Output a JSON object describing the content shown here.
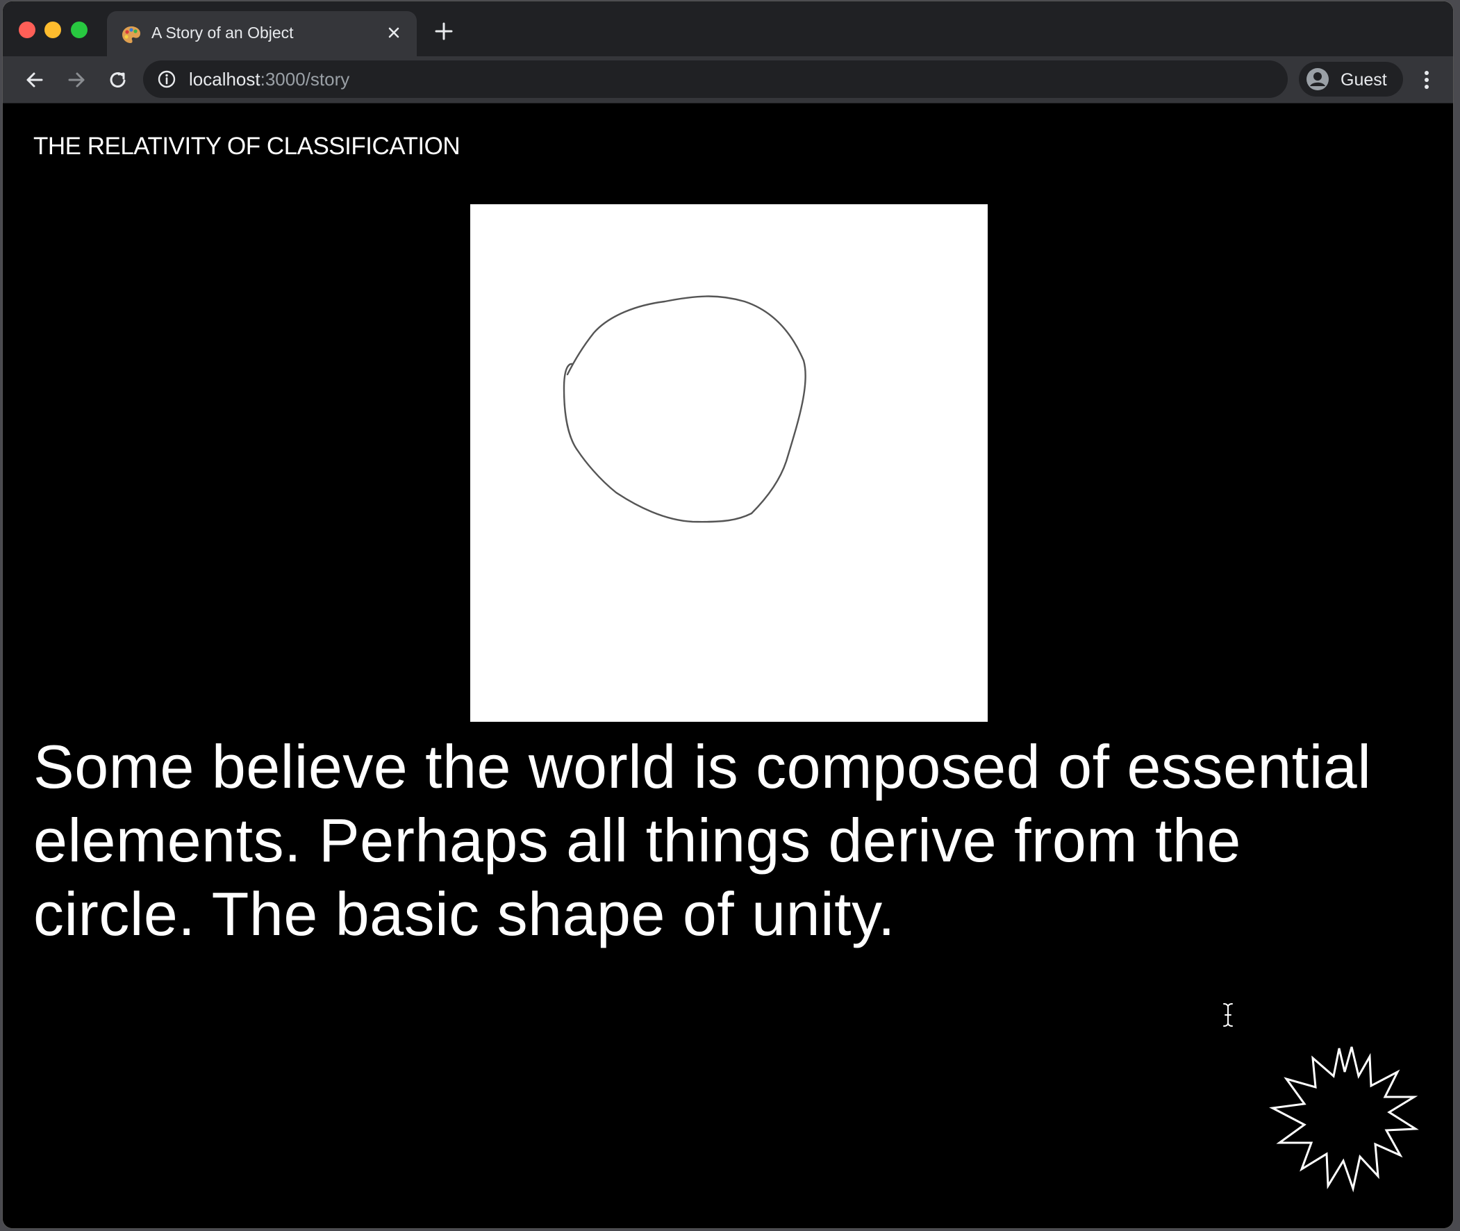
{
  "browser": {
    "tab": {
      "title": "A Story of an Object",
      "favicon": "palette-icon"
    },
    "address": {
      "host": "localhost",
      "path": ":3000/story"
    },
    "profile": {
      "label": "Guest"
    }
  },
  "page": {
    "heading": "THE RELATIVITY OF CLASSIFICATION",
    "story": "Some believe the world is composed of essential elements. Perhaps all things derive from the circle. The basic shape of unity.",
    "drawing": {
      "shape": "hand-drawn circle",
      "background": "#ffffff",
      "stroke": "#555555"
    },
    "next_control": {
      "icon": "starburst-icon"
    }
  },
  "colors": {
    "page_background": "#000000",
    "text": "#ffffff",
    "chrome_dark": "#202124",
    "chrome_mid": "#35363a"
  }
}
